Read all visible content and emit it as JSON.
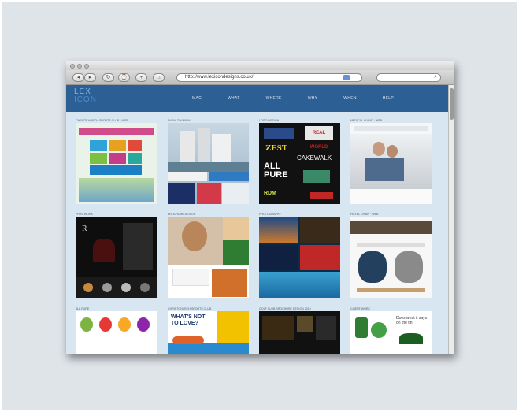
{
  "browser": {
    "url": "http://www.lexicondesigns.co.uk/",
    "search_placeholder": "",
    "buttons": {
      "back": "◂",
      "forward": "▸",
      "reload": "↻",
      "history": "⌚",
      "plus": "+",
      "home": "⌂"
    }
  },
  "site": {
    "logo_line1": "LEX",
    "logo_line2": "ICON",
    "nav": [
      "MAC",
      "WHAT",
      "WHERE",
      "WHY",
      "WHEN",
      "HELP"
    ]
  },
  "tiles": [
    {
      "label": "CHRISTCHURCH SPORTS CLUB · WEB"
    },
    {
      "label": "DUBAI TOURISM"
    },
    {
      "label": "LOGO DESIGN"
    },
    {
      "label": "MEDICAL CLINIC · WEB"
    },
    {
      "label": "PRINTWORK"
    },
    {
      "label": "BROCHURE DESIGN"
    },
    {
      "label": "PHOTOGRAPHY"
    },
    {
      "label": "HOTEL CHAIN · WEB"
    },
    {
      "label": "ALL PURE"
    },
    {
      "label": "CHRISTCHURCH SPORTS CLUB"
    },
    {
      "label": "GOLF CLUB BROCHURE DESIGN 2010"
    },
    {
      "label": "CLIENT WORK"
    }
  ],
  "tile_text": {
    "logo_zest": "ZEST",
    "logo_real": "REAL WORLD",
    "logo_cakewalk": "CAKEWALK",
    "logo_allpure": "ALL PURE",
    "logo_rdm": "RDM",
    "whats_not": "WHAT'S NOT TO LOVE?",
    "drink": "Does what it says on the tin."
  },
  "colors": {
    "header": "#2c5f94",
    "page": "#d8e6f2",
    "panel": "#dfe4e9"
  }
}
